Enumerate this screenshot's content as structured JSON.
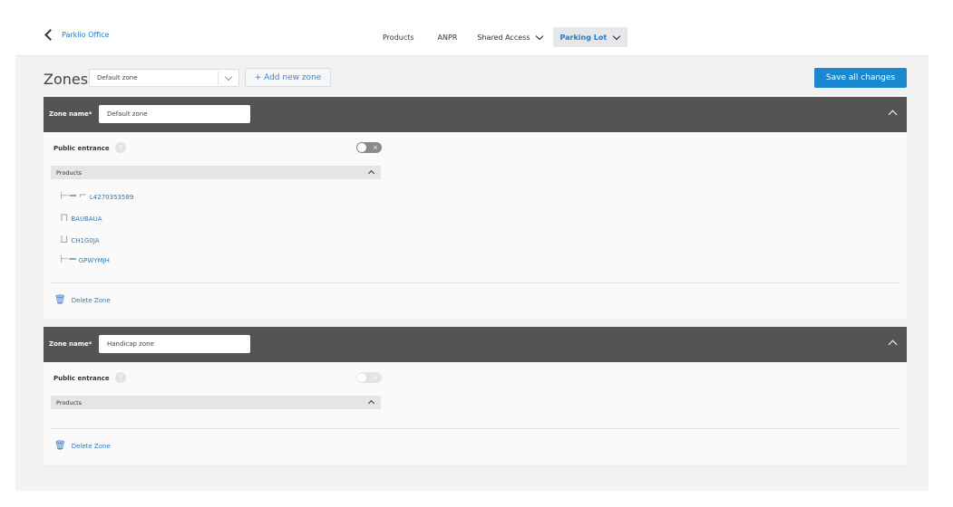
{
  "header": {
    "back_label": "Parklio Office",
    "nav": [
      {
        "label": "Products"
      },
      {
        "label": "ANPR"
      },
      {
        "label": "Shared Access"
      },
      {
        "label": "Parking Lot"
      }
    ]
  },
  "zones": {
    "title": "Zones",
    "selected_zone": "Default zone",
    "add_zone_label": "+ Add new zone",
    "save_label": "Save all changes"
  },
  "cards": [
    {
      "name_label": "Zone name*",
      "name_value": "Default zone",
      "public_entrance_label": "Public entrance",
      "help_glyph": "?",
      "toggle_glyph": "×",
      "products_label": "Products",
      "products": [
        {
          "icon": "barrier-icon",
          "code": "L4270353589"
        },
        {
          "icon": "gate-icon",
          "code": "BAUBAUA"
        },
        {
          "icon": "lock-icon",
          "code": "CH1G0JA"
        },
        {
          "icon": "barrier-icon",
          "code": "GPWYMJH"
        }
      ],
      "delete_label": "Delete Zone"
    },
    {
      "name_label": "Zone name*",
      "name_value": "Handicap zone",
      "public_entrance_label": "Public entrance",
      "help_glyph": "?",
      "toggle_glyph": "×",
      "products_label": "Products",
      "products": [],
      "delete_label": "Delete Zone"
    }
  ]
}
